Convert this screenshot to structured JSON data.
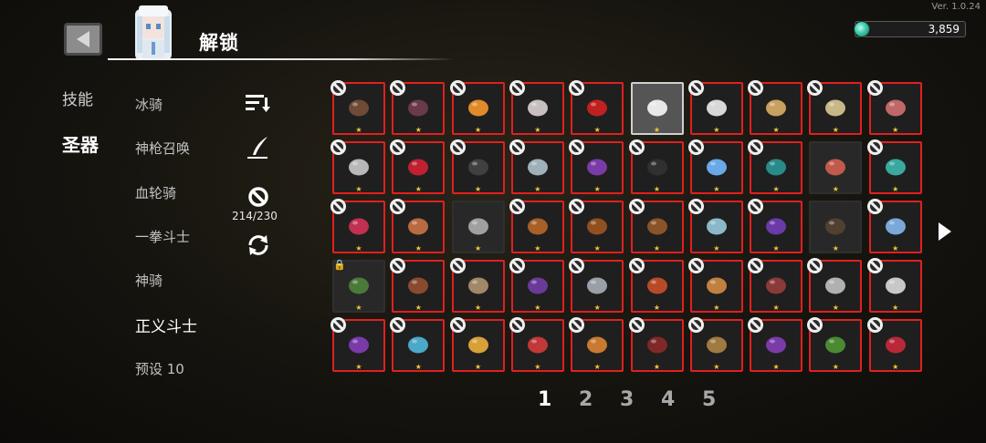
{
  "version": "Ver. 1.0.24",
  "header": {
    "title": "解锁",
    "currency_value": "3,859"
  },
  "categories": [
    {
      "label": "技能",
      "active": false
    },
    {
      "label": "圣器",
      "active": true
    }
  ],
  "presets": [
    {
      "label": "冰骑"
    },
    {
      "label": "神枪召唤"
    },
    {
      "label": "血轮骑"
    },
    {
      "label": "一拳斗士"
    },
    {
      "label": "神骑"
    },
    {
      "label": "正义斗士",
      "active": true
    },
    {
      "label": "预设 10"
    }
  ],
  "tools": {
    "count": "214/230",
    "icons": [
      "sort-icon",
      "quill-icon",
      "ban-icon",
      "refresh-icon"
    ]
  },
  "grid": {
    "rows": [
      [
        {
          "icon": "rune-stone",
          "state": "banned",
          "color": "#6e4a37"
        },
        {
          "icon": "dark-orb",
          "state": "banned",
          "color": "#6b3a4a"
        },
        {
          "icon": "amber-crystal",
          "state": "banned",
          "color": "#e08a2a"
        },
        {
          "icon": "feather",
          "state": "banned",
          "color": "#c8bfc0"
        },
        {
          "icon": "red-potion",
          "state": "banned",
          "color": "#c02020"
        },
        {
          "icon": "fox-mask",
          "state": "selected",
          "color": "#e8e8e8"
        },
        {
          "icon": "skull",
          "state": "banned",
          "color": "#d8d8d8"
        },
        {
          "icon": "scroll",
          "state": "banned",
          "color": "#c8a060"
        },
        {
          "icon": "scroll-ii",
          "state": "banned",
          "color": "#c8b888"
        },
        {
          "icon": "meat",
          "state": "banned",
          "color": "#c06868"
        }
      ],
      [
        {
          "icon": "sparkle",
          "state": "banned",
          "color": "#b8b8b8"
        },
        {
          "icon": "demon-crown",
          "state": "banned",
          "color": "#c02030"
        },
        {
          "icon": "black-helmet",
          "state": "banned",
          "color": "#404040"
        },
        {
          "icon": "shard",
          "state": "banned",
          "color": "#a0b0b8"
        },
        {
          "icon": "purple-crystal",
          "state": "banned",
          "color": "#7a3aa8"
        },
        {
          "icon": "black-rock",
          "state": "banned",
          "color": "#303030"
        },
        {
          "icon": "blue-claw",
          "state": "banned",
          "color": "#6aa8e8"
        },
        {
          "icon": "teal-tree",
          "state": "banned",
          "color": "#2a8a8a"
        },
        {
          "icon": "red-mushroom",
          "state": "plain",
          "color": "#c05a4a"
        },
        {
          "icon": "teal-orbs",
          "state": "banned",
          "color": "#3aa8a0"
        }
      ],
      [
        {
          "icon": "red-scarf",
          "state": "banned",
          "color": "#c03050"
        },
        {
          "icon": "clay-vase",
          "state": "banned",
          "color": "#b86a40"
        },
        {
          "icon": "spoon",
          "state": "plain",
          "color": "#a0a0a0"
        },
        {
          "icon": "boot",
          "state": "banned",
          "color": "#a86028"
        },
        {
          "icon": "gloves",
          "state": "banned",
          "color": "#905020"
        },
        {
          "icon": "wood-plank",
          "state": "banned",
          "color": "#8a5428"
        },
        {
          "icon": "crystal-ball",
          "state": "banned",
          "color": "#8ab8c8"
        },
        {
          "icon": "purple-lantern",
          "state": "banned",
          "color": "#6a3aa8"
        },
        {
          "icon": "wood-box",
          "state": "plain",
          "color": "#504030"
        },
        {
          "icon": "blue-cube",
          "state": "banned",
          "color": "#7aa8d8"
        }
      ],
      [
        {
          "icon": "green-shell",
          "state": "locked",
          "color": "#4a7a3a"
        },
        {
          "icon": "crossbow",
          "state": "banned",
          "color": "#8a4a30"
        },
        {
          "icon": "cloth-bag",
          "state": "banned",
          "color": "#a08868"
        },
        {
          "icon": "purple-staff",
          "state": "banned",
          "color": "#6a3a98"
        },
        {
          "icon": "crossed-swords",
          "state": "banned",
          "color": "#9aa0a8"
        },
        {
          "icon": "fire-bracer",
          "state": "banned",
          "color": "#b84a28"
        },
        {
          "icon": "blue-book",
          "state": "banned",
          "color": "#c08040"
        },
        {
          "icon": "red-wing",
          "state": "banned",
          "color": "#8a3a38"
        },
        {
          "icon": "dagger",
          "state": "banned",
          "color": "#b0b0b0"
        },
        {
          "icon": "sword",
          "state": "banned",
          "color": "#c8c8c8"
        }
      ],
      [
        {
          "icon": "purple-ring",
          "state": "banned",
          "color": "#7a3aa8"
        },
        {
          "icon": "blue-spider",
          "state": "banned",
          "color": "#4aa8c8"
        },
        {
          "icon": "gold-bars",
          "state": "banned",
          "color": "#d8a038"
        },
        {
          "icon": "red-shoe",
          "state": "banned",
          "color": "#c03838"
        },
        {
          "icon": "orange-orb",
          "state": "banned",
          "color": "#c87a30"
        },
        {
          "icon": "red-spider",
          "state": "banned",
          "color": "#802828"
        },
        {
          "icon": "bread",
          "state": "banned",
          "color": "#a07a40"
        },
        {
          "icon": "purple-gem",
          "state": "banned",
          "color": "#7a3aa8"
        },
        {
          "icon": "green-grapes",
          "state": "banned",
          "color": "#4a8a30"
        },
        {
          "icon": "red-fruit",
          "state": "banned",
          "color": "#b82838"
        }
      ]
    ]
  },
  "pagination": {
    "pages": [
      "1",
      "2",
      "3",
      "4",
      "5"
    ],
    "current": 0
  }
}
